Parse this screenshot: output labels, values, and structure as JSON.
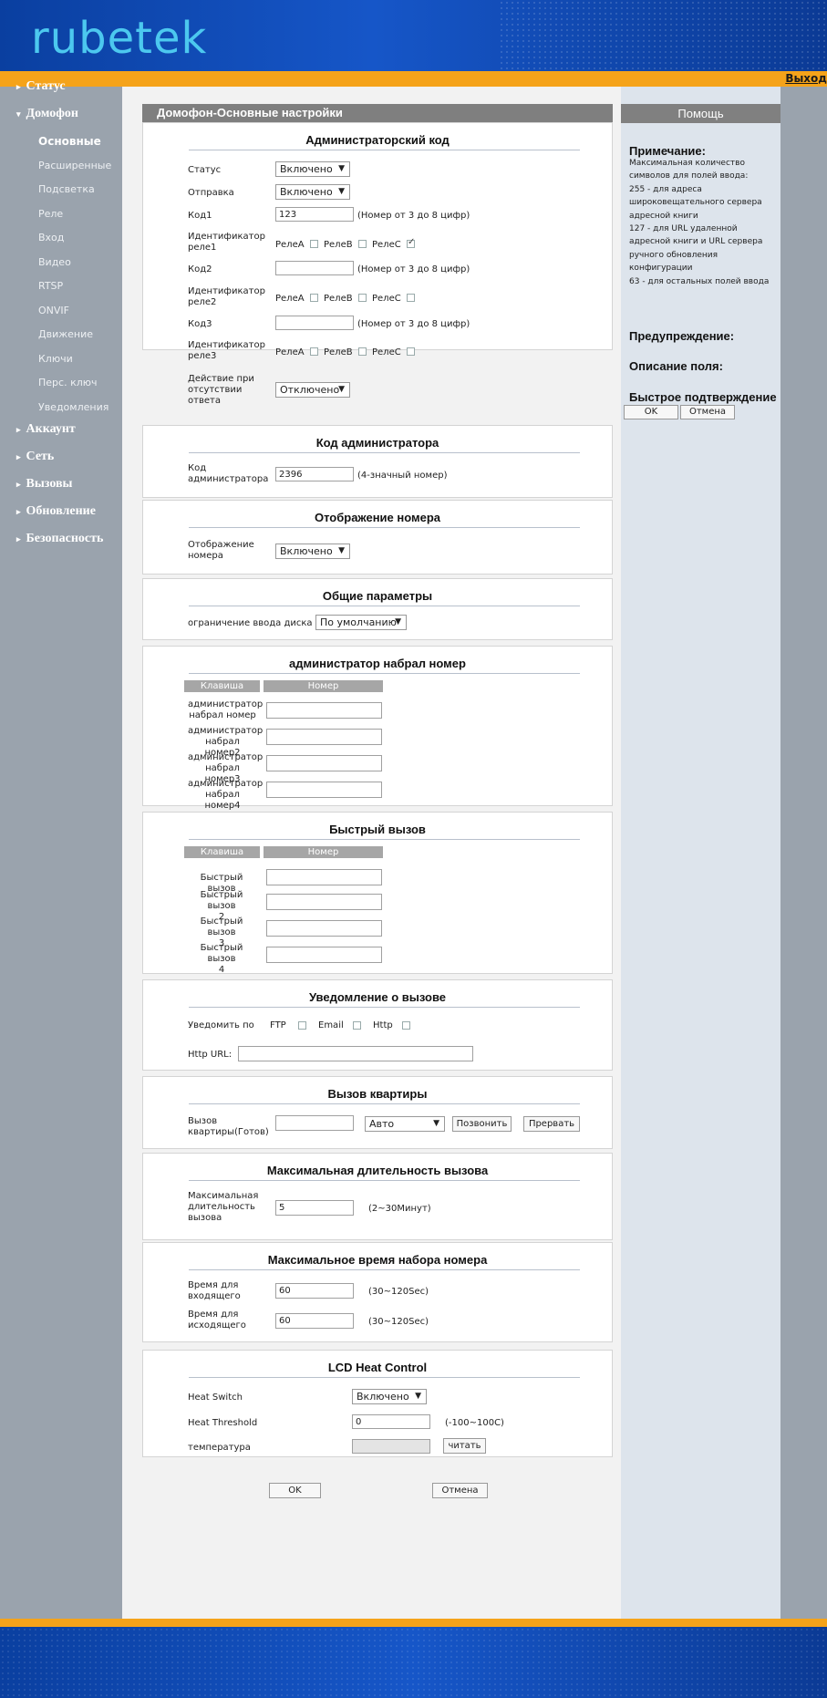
{
  "header": {
    "logo": "rubetek",
    "logout": "Выход"
  },
  "sidebar": {
    "items": [
      {
        "label": "Статус",
        "marker": "▸"
      },
      {
        "label": "Домофон",
        "marker": "▾"
      },
      {
        "label": "Аккаунт",
        "marker": "▸"
      },
      {
        "label": "Сеть",
        "marker": "▸"
      },
      {
        "label": "Вызовы",
        "marker": "▸"
      },
      {
        "label": "Обновление",
        "marker": "▸"
      },
      {
        "label": "Безопасность",
        "marker": "▸"
      }
    ],
    "subitems": [
      "Основные",
      "Расширенные",
      "Подсветка",
      "Реле",
      "Вход",
      "Видео",
      "RTSP",
      "ONVIF",
      "Движение",
      "Ключи",
      "Перс. ключ",
      "Уведомления"
    ]
  },
  "page": {
    "title": "Домофон-Основные настройки"
  },
  "admin_code": {
    "title": "Администраторский код",
    "status_label": "Статус",
    "status_value": "Включено",
    "send_label": "Отправка",
    "send_value": "Включено",
    "code1_label": "Код1",
    "code1_value": "123",
    "code_hint": "(Номер от 3 до 8 цифр)",
    "relay_id_label1": "Идентификатор",
    "relay_id_label2_1": "реле1",
    "relay_id_label2_2": "реле2",
    "relay_id_label2_3": "реле3",
    "relay_a": "РелеА",
    "relay_b": "РелеB",
    "relay_c": "РелеC",
    "code2_label": "Код2",
    "code2_value": "",
    "code3_label": "Код3",
    "code3_value": "",
    "no_answer_label": [
      "Действие при",
      "отсутствии",
      "ответа"
    ],
    "no_answer_value": "Отключено"
  },
  "admin_code2": {
    "title": "Код администратора",
    "label": [
      "Код",
      "администратора"
    ],
    "value": "2396",
    "hint": "(4-значный номер)"
  },
  "number_display": {
    "title": "Отображение номера",
    "label": [
      "Отображение",
      "номера"
    ],
    "value": "Включено"
  },
  "general": {
    "title": "Общие параметры",
    "label": "ограничение ввода диска",
    "value": "По умолчанию"
  },
  "admin_dial": {
    "title": "администратор набрал номер",
    "col_key": "Клавиша",
    "col_number": "Номер",
    "rows": [
      {
        "l1": "администратор",
        "l2": "набрал номер",
        "value": ""
      },
      {
        "l1": "администратор",
        "l2": "набрал номер2",
        "value": ""
      },
      {
        "l1": "администратор",
        "l2": "набрал номер3",
        "value": ""
      },
      {
        "l1": "администратор",
        "l2": "набрал номер4",
        "value": ""
      }
    ]
  },
  "speed_dial": {
    "title": "Быстрый вызов",
    "col_key": "Клавиша",
    "col_number": "Номер",
    "rows": [
      {
        "l1": "Быстрый вызов",
        "l2": "",
        "value": ""
      },
      {
        "l1": "Быстрый вызов",
        "l2": "2",
        "value": ""
      },
      {
        "l1": "Быстрый вызов",
        "l2": "3",
        "value": ""
      },
      {
        "l1": "Быстрый вызов",
        "l2": "4",
        "value": ""
      }
    ]
  },
  "call_notify": {
    "title": "Уведомление о вызове",
    "notify_by": "Уведомить по",
    "ftp": "FTP",
    "email": "Email",
    "http": "Http",
    "url_label": "Http URL:",
    "url_value": ""
  },
  "apt_call": {
    "title": "Вызов квартиры",
    "label": [
      "Вызов",
      "квартиры(Готов)"
    ],
    "value": "",
    "mode": "Авто",
    "call_btn": "Позвонить",
    "stop_btn": "Прервать"
  },
  "max_call": {
    "title": "Максимальная длительность вызова",
    "label": [
      "Максимальная",
      "длительность",
      "вызова"
    ],
    "value": "5",
    "hint": "(2~30Минут)"
  },
  "max_dial": {
    "title": "Максимальное время набора номера",
    "in_label": [
      "Время для",
      "входящего"
    ],
    "in_value": "60",
    "out_label": [
      "Время для",
      "исходящего"
    ],
    "out_value": "60",
    "hint": "(30~120Sec)"
  },
  "lcd": {
    "title": "LCD Heat Control",
    "switch_label": "Heat Switch",
    "switch_value": "Включено",
    "threshold_label": "Heat Threshold",
    "threshold_value": "0",
    "threshold_hint": "(-100~100C)",
    "temp_label": "температура",
    "temp_value": "",
    "read_btn": "читать"
  },
  "actions": {
    "ok": "OK",
    "cancel": "Отмена"
  },
  "help": {
    "title": "Помощь",
    "note_title": "Примечание:",
    "note_lines": [
      "Максимальная количество",
      "символов для полей ввода:",
      "255 - для адреса",
      "широковещательного сервера",
      "адресной книги",
      "127 - для URL удаленной",
      "адресной книги и URL сервера",
      "ручного обновления",
      "конфигурации",
      "63 - для остальных полей ввода"
    ],
    "warning": "Предупреждение:",
    "field_desc": "Описание поля:",
    "quick_confirm": "Быстрое подтверждение",
    "ok": "OK",
    "cancel": "Отмена"
  },
  "colors": {
    "accent_orange": "#f5a31a",
    "header_blue": "#1656c8",
    "logo_cyan": "#4cc8ef",
    "sidebar_gray": "#9aa3ad"
  }
}
